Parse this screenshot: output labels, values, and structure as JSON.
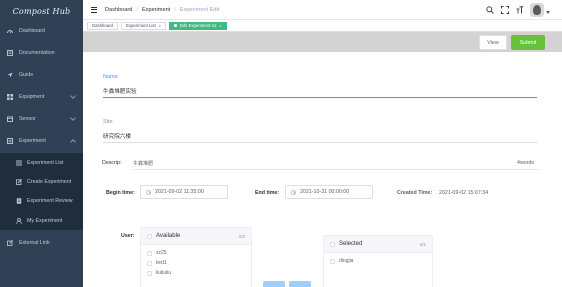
{
  "sidebar": {
    "logo_text": "Compost Hub",
    "items": [
      {
        "label": "Dashboard",
        "icon": "dashboard-icon"
      },
      {
        "label": "Documentation",
        "icon": "documentation-icon"
      },
      {
        "label": "Guide",
        "icon": "guide-icon"
      },
      {
        "label": "Equipment",
        "icon": "equipment-icon"
      },
      {
        "label": "Sensor",
        "icon": "sensor-icon"
      },
      {
        "label": "Experiment",
        "icon": "experiment-icon"
      }
    ],
    "experiment_submenu": [
      {
        "label": "Experiment List",
        "icon": "list-icon"
      },
      {
        "label": "Create Experiment",
        "icon": "edit-icon"
      },
      {
        "label": "Experiment Review",
        "icon": "document-icon"
      },
      {
        "label": "My Experiment",
        "icon": "user-icon"
      }
    ],
    "external_link": {
      "label": "External Link",
      "icon": "external-link-icon"
    }
  },
  "breadcrumb": [
    "Dashboard",
    "Experiment",
    "Experiment Edit"
  ],
  "tags": [
    {
      "label": "Dashboard",
      "active": false
    },
    {
      "label": "Experiment List",
      "active": false
    },
    {
      "label": "Edit Experiment-11",
      "active": true
    }
  ],
  "actions": {
    "view_label": "View",
    "submit_label": "Submit"
  },
  "form": {
    "name_label": "Name",
    "name_value": "牛粪堆肥实验",
    "site_label": "Site",
    "site_value": "研究院六楼",
    "description_label": "Descrip:",
    "description_value": "牛粪堆肥",
    "word_count": "4words",
    "begin_label": "Begin time:",
    "begin_value": "2021-09-02 11:35:00",
    "end_label": "End time:",
    "end_value": "2021-10-31 00:00:00",
    "created_label": "Created Time:",
    "created_value": "2021-09-02 15:07:34",
    "user_label": "User:"
  },
  "transfer": {
    "left": {
      "title": "Available",
      "count": "0/3",
      "items": [
        "zz25",
        "test1",
        "liuliuliu"
      ]
    },
    "right": {
      "title": "Selected",
      "count": "0/1",
      "items": [
        "dingjia"
      ]
    }
  },
  "colors": {
    "sidebar_bg": "#304156",
    "submenu_bg": "#1f2d3d",
    "accent_blue": "#409eff",
    "tag_active": "#42b983",
    "submit_green": "#67c23a"
  }
}
